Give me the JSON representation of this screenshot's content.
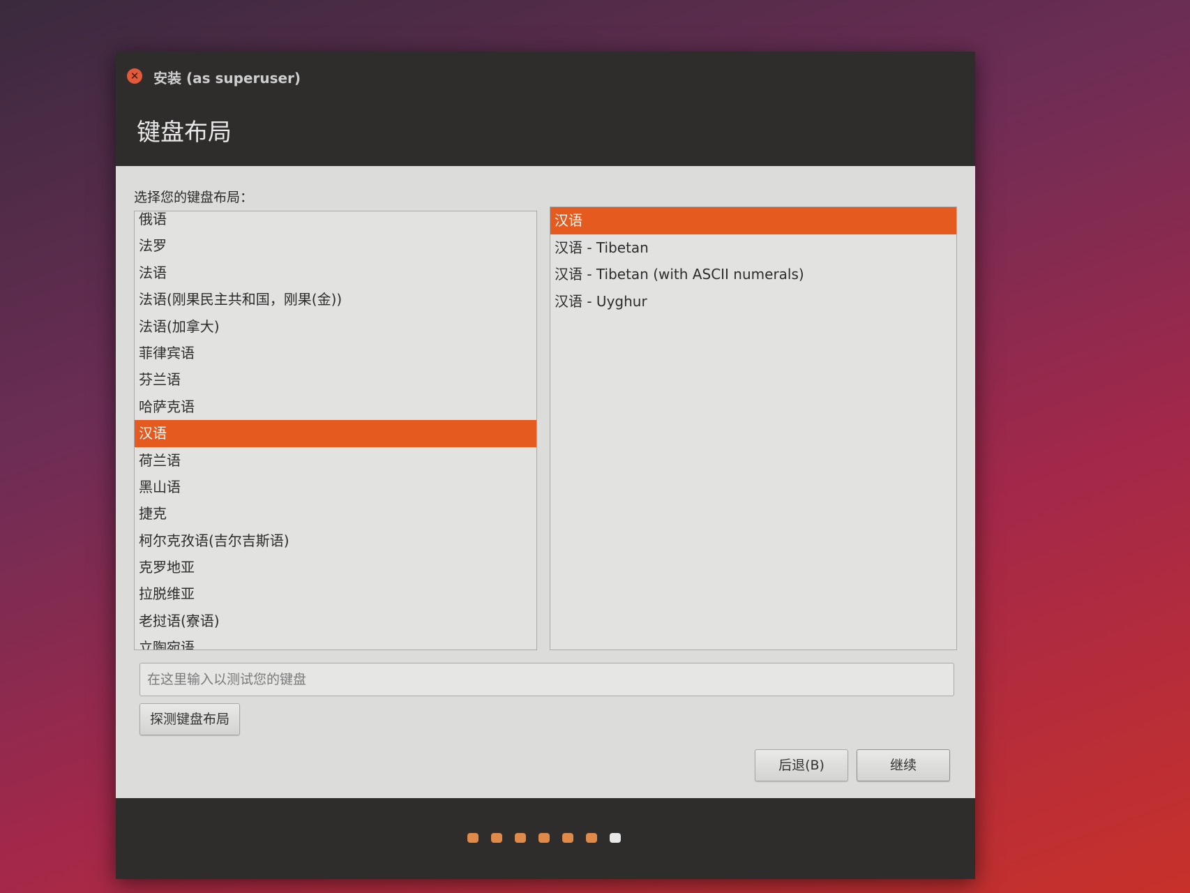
{
  "window": {
    "title": "安装 (as superuser)",
    "page_title": "键盘布局"
  },
  "content": {
    "prompt": "选择您的键盘布局：",
    "layouts": [
      {
        "label": "俄语",
        "selected": false
      },
      {
        "label": "法罗",
        "selected": false
      },
      {
        "label": "法语",
        "selected": false
      },
      {
        "label": "法语(刚果民主共和国，刚果(金))",
        "selected": false
      },
      {
        "label": "法语(加拿大)",
        "selected": false
      },
      {
        "label": "菲律宾语",
        "selected": false
      },
      {
        "label": "芬兰语",
        "selected": false
      },
      {
        "label": "哈萨克语",
        "selected": false
      },
      {
        "label": "汉语",
        "selected": true
      },
      {
        "label": "荷兰语",
        "selected": false
      },
      {
        "label": "黑山语",
        "selected": false
      },
      {
        "label": "捷克",
        "selected": false
      },
      {
        "label": "柯尔克孜语(吉尔吉斯语)",
        "selected": false
      },
      {
        "label": "克罗地亚",
        "selected": false
      },
      {
        "label": "拉脱维亚",
        "selected": false
      },
      {
        "label": "老挝语(寮语)",
        "selected": false
      },
      {
        "label": "立陶宛语",
        "selected": false
      }
    ],
    "variants": [
      {
        "label": "汉语",
        "selected": true
      },
      {
        "label": "汉语 - Tibetan",
        "selected": false
      },
      {
        "label": "汉语 - Tibetan (with ASCII numerals)",
        "selected": false
      },
      {
        "label": "汉语 - Uyghur",
        "selected": false
      }
    ],
    "test_placeholder": "在这里输入以测试您的键盘",
    "detect_button": "探测键盘布局"
  },
  "buttons": {
    "back": "后退(B)",
    "continue": "继续"
  },
  "progress": {
    "total_steps": 7,
    "current_step": 7
  },
  "colors": {
    "accent": "#e45a1f",
    "titlebar": "#2f2d2c"
  }
}
